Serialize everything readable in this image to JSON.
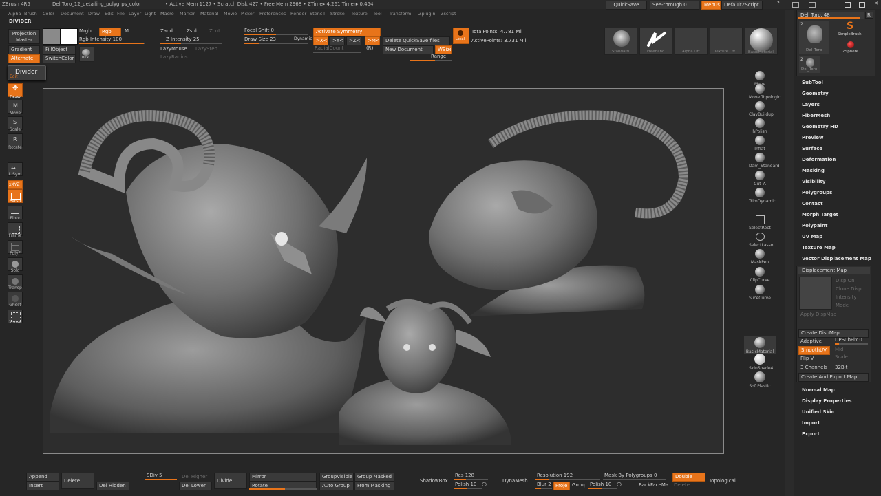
{
  "titlebar": {
    "app": "ZBrush 4R5",
    "doc": "Del Toro_12_detailing_polygrps_color",
    "mem": "• Active Mem 1127 • Scratch Disk 427 • Free Mem 2968 • ZTime▸ 4.261 Timer▸ 0.454",
    "quicksave": "QuickSave",
    "seethrough": "See-through 0",
    "menus": "Menus",
    "zscript": "DefaultZScript"
  },
  "menubar": [
    "Alpha",
    "Brush",
    "Color",
    "Document",
    "Draw",
    "Edit",
    "File",
    "Layer",
    "Light",
    "Macro",
    "Marker",
    "Material",
    "Movie",
    "Picker",
    "Preferences",
    "Render",
    "Stencil",
    "Stroke",
    "Texture",
    "Tool",
    "Transform",
    "Zplugin",
    "Zscript"
  ],
  "shelf": {
    "divider": "DIVIDER",
    "projection_master": "Projection Master",
    "mrgb": "Mrgb",
    "rgb": "Rgb",
    "m": "M",
    "rgb_intensity": "Rgb Intensity 100",
    "gradient": "Gradient",
    "fillobject": "FillObject",
    "alternate": "Alternate",
    "switchcolor": "SwitchColor",
    "bpr": "BPR",
    "zadd": "Zadd",
    "zsub": "Zsub",
    "zcut": "Zcut",
    "z_intensity": "Z Intensity 25",
    "lazymouse": "LazyMouse",
    "lazystep": "LazyStep",
    "lazyradius": "LazyRadius",
    "focal_shift": "Focal Shift 0",
    "draw_size": "Draw Size 23",
    "dynamic": "Dynamic",
    "activate_symmetry": "Activate Symmetry",
    "sym_x": ">X<",
    "sym_y": ">Y<",
    "sym_z": ">Z<",
    "sym_m": ">M<",
    "radialcount": "RadialCount",
    "r": "(R)",
    "delete_quicksave": "Delete QuickSave files",
    "new_document": "New Document",
    "wsize": "WSize",
    "range": "Range",
    "local": "Local",
    "total_points": "TotalPoints: 4.781 Mil",
    "active_points": "ActivePoints: 3.731 Mil",
    "thumbs": [
      "Standard",
      "Freehand",
      "Alpha Off",
      "Texture Off",
      "BasicMaterial"
    ]
  },
  "tooltip": "Divider",
  "left_tools": [
    "Edit",
    "Draw",
    "Move",
    "Scale",
    "Rotate",
    "L.Sym",
    "Persp",
    "Floor",
    "Frame",
    "PolyF",
    "Solo",
    "Transp",
    "Ghost",
    "Xpose"
  ],
  "left_badges": {
    "edit": "Edit",
    "xyz": "xXYZ"
  },
  "brushes": [
    "Move",
    "Move Topologic",
    "ClayBuildup",
    "hPolish",
    "Inflat",
    "Dam_Standard",
    "Cut_A",
    "TrimDynamic",
    "SelectRect",
    "SelectLasso",
    "MaskPen",
    "ClipCurve",
    "SliceCurve",
    "BasicMaterial",
    "SkinShade4",
    "SoftPlastic"
  ],
  "tool_palette": {
    "name": "Del_Toro. 48",
    "r": "R",
    "items": [
      "Del_Toro",
      "SimpleBrush",
      "ZSphere",
      "Del_Toro"
    ],
    "num2a": "2",
    "num2b": "2"
  },
  "subpalettes_top": [
    "SubTool",
    "Geometry",
    "Layers",
    "FiberMesh",
    "Geometry HD",
    "Preview",
    "Surface",
    "Deformation",
    "Masking",
    "Visibility",
    "Polygroups",
    "Contact",
    "Morph Target",
    "Polypaint",
    "UV Map",
    "Texture Map",
    "Vector Displacement Map"
  ],
  "displacement": {
    "header": "Displacement Map",
    "disp_on": "Disp On",
    "clone_disp": "Clone Disp",
    "intensity": "Intensity",
    "mode": "Mode",
    "apply": "Apply DispMap",
    "create": "Create DispMap",
    "adaptive": "Adaptive",
    "dpsubpix": "DPSubPix 0",
    "smoothuv": "SmoothUV",
    "mid": "Mid",
    "flipv": "Flip V",
    "scale": "Scale",
    "channels": "3 Channels",
    "bit": "32Bit",
    "export": "Create And Export Map"
  },
  "subpalettes_bottom": [
    "Normal Map",
    "Display Properties",
    "Unified Skin",
    "Import",
    "Export"
  ],
  "bottom": {
    "append": "Append",
    "insert": "Insert",
    "delete": "Delete",
    "del_hidden": "Del Hidden",
    "sdiv": "SDiv 5",
    "del_higher": "Del Higher",
    "del_lower": "Del Lower",
    "divide": "Divide",
    "mirror": "Mirror",
    "rotate": "Rotate",
    "groupvisible": "GroupVisible",
    "group_masked": "Group Masked",
    "auto_group": "Auto Group",
    "from_masking": "From Masking",
    "shadowbox": "ShadowBox",
    "res": "Res 128",
    "polish": "Polish 10",
    "dynamesh": "DynaMesh",
    "resolution": "Resolution 192",
    "blur": "Blur 2",
    "project": "Proje",
    "group": "Group",
    "polish2": "Polish 10",
    "mask_by_polygroups": "Mask By Polygroups 0",
    "backfacemask": "BackFaceMa",
    "double": "Double",
    "delete2": "Delete",
    "topological": "Topological"
  }
}
